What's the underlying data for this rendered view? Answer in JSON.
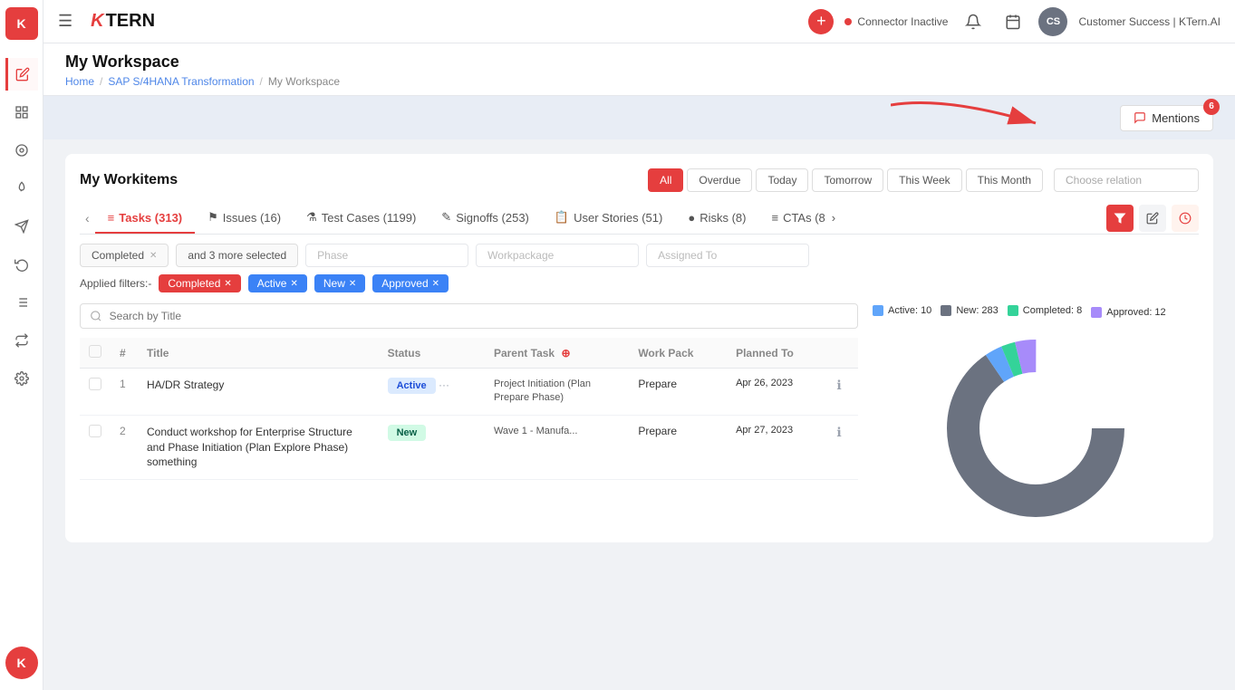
{
  "app": {
    "title": "KTern.AI",
    "logo_k": "K",
    "logo_tern": "TERN"
  },
  "topnav": {
    "connector_label": "Connector Inactive",
    "user_initials": "CS",
    "user_label": "Customer Success | KTern.AI"
  },
  "page": {
    "title": "My Workspace",
    "breadcrumb": [
      "Home",
      "SAP S/4HANA Transformation",
      "My Workspace"
    ]
  },
  "mentions": {
    "label": "Mentions",
    "badge_count": "6"
  },
  "workitems": {
    "title": "My Workitems",
    "filter_tabs": [
      {
        "label": "All",
        "active": true
      },
      {
        "label": "Overdue",
        "active": false
      },
      {
        "label": "Today",
        "active": false
      },
      {
        "label": "Tomorrow",
        "active": false
      },
      {
        "label": "This Week",
        "active": false
      },
      {
        "label": "This Month",
        "active": false
      }
    ],
    "choose_relation": "Choose relation"
  },
  "tabs": [
    {
      "label": "Tasks (313)",
      "icon": "≡",
      "active": true
    },
    {
      "label": "Issues (16)",
      "icon": "⚑",
      "active": false
    },
    {
      "label": "Test Cases (1199)",
      "icon": "⚗",
      "active": false
    },
    {
      "label": "Signoffs (253)",
      "icon": "✎",
      "active": false
    },
    {
      "label": "User Stories (51)",
      "icon": "📋",
      "active": false
    },
    {
      "label": "Risks (8)",
      "icon": "●",
      "active": false
    },
    {
      "label": "CTAs (8",
      "icon": "≡",
      "active": false
    }
  ],
  "filters": {
    "phase_placeholder": "Phase",
    "workpackage_placeholder": "Workpackage",
    "assigned_to_placeholder": "Assigned To",
    "status_chip": "Completed",
    "more_chip": "and 3 more selected"
  },
  "applied_filters": {
    "label": "Applied filters:-",
    "tags": [
      {
        "label": "Completed",
        "color": "red"
      },
      {
        "label": "Active",
        "color": "blue"
      },
      {
        "label": "New",
        "color": "blue"
      },
      {
        "label": "Approved",
        "color": "blue"
      }
    ]
  },
  "search": {
    "placeholder": "Search by Title"
  },
  "table": {
    "columns": [
      "#",
      "Title",
      "Status",
      "Parent Task",
      "Work Pack",
      "Planned To"
    ],
    "rows": [
      {
        "num": "1",
        "title": "HA/DR Strategy",
        "status": "Active",
        "status_type": "active",
        "parent_task": "Project Initiation (Plan Prepare Phase)",
        "work_pack": "Prepare",
        "planned_to": "Apr 26, 2023"
      },
      {
        "num": "2",
        "title": "Conduct workshop for Enterprise Structure and Phase Initiation (Plan Explore Phase) something",
        "status": "New",
        "status_type": "new",
        "parent_task": "Wave 1 - Manufa...",
        "work_pack": "Prepare",
        "planned_to": "Apr 27, 2023"
      }
    ]
  },
  "chart": {
    "legend": [
      {
        "label": "Active: 10",
        "color": "#60a5fa"
      },
      {
        "label": "New: 283",
        "color": "#6b7280"
      },
      {
        "label": "Completed: 8",
        "color": "#34d399"
      },
      {
        "label": "Approved: 12",
        "color": "#a78bfa"
      }
    ],
    "segments": [
      {
        "value": 283,
        "color": "#6b7280"
      },
      {
        "value": 10,
        "color": "#60a5fa"
      },
      {
        "value": 8,
        "color": "#34d399"
      },
      {
        "value": 12,
        "color": "#a78bfa"
      }
    ]
  },
  "sidebar": {
    "items": [
      {
        "icon": "☰",
        "name": "menu"
      },
      {
        "icon": "✎",
        "name": "edit",
        "active": true
      },
      {
        "icon": "⊞",
        "name": "grid"
      },
      {
        "icon": "◎",
        "name": "circle"
      },
      {
        "icon": "◬",
        "name": "fire"
      },
      {
        "icon": "✈",
        "name": "send"
      },
      {
        "icon": "↻",
        "name": "refresh"
      },
      {
        "icon": "≡",
        "name": "list"
      },
      {
        "icon": "⇌",
        "name": "switch"
      },
      {
        "icon": "⚙",
        "name": "settings"
      }
    ]
  }
}
